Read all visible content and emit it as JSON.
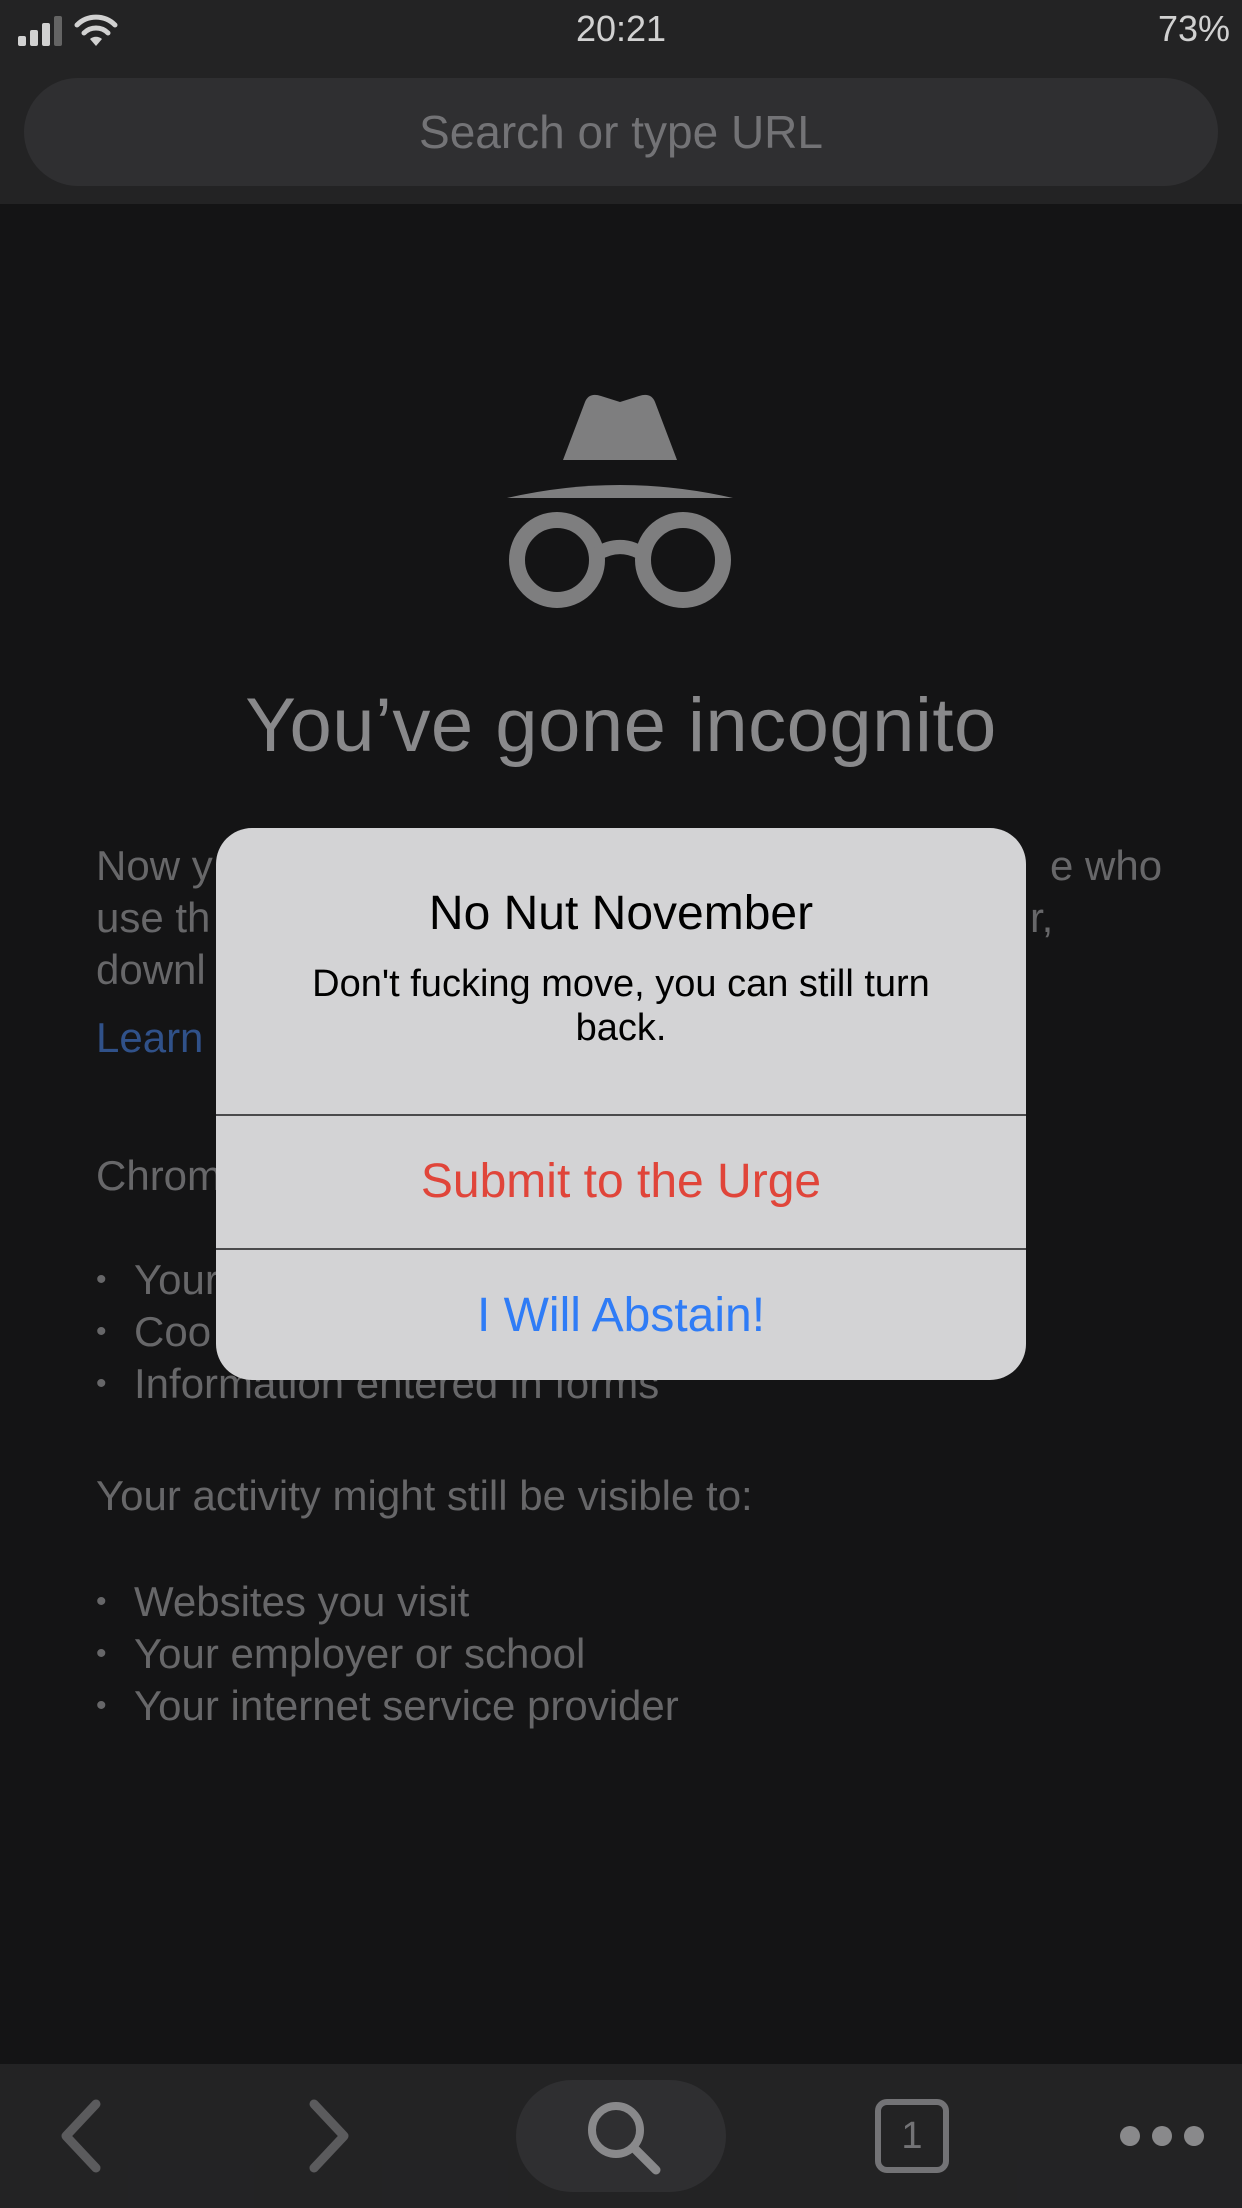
{
  "status_bar": {
    "time": "20:21",
    "battery": "73%"
  },
  "omnibox": {
    "placeholder": "Search or type URL"
  },
  "incognito": {
    "title": "You’ve gone incognito",
    "intro_visible_lines": [
      "Now y",
      "use th",
      "downl"
    ],
    "intro_right_fragments": [
      "e who",
      "r,"
    ],
    "learn_more": "Learn",
    "chrome_fragment": "Chrom",
    "not_saved_items": [
      "Your",
      "Coo",
      "Information entered in forms"
    ],
    "visible_to_heading": "Your activity might still be visible to:",
    "visible_to_items": [
      "Websites you visit",
      "Your employer or school",
      "Your internet service provider"
    ]
  },
  "alert": {
    "title": "No Nut November",
    "message": "Don't fucking move, you can still turn back.",
    "destructive_button": "Submit to the Urge",
    "default_button": "I Will Abstain!"
  },
  "toolbar": {
    "tab_count": "1",
    "icons": [
      "back-icon",
      "forward-icon",
      "search-icon",
      "tabs-icon",
      "more-icon"
    ]
  },
  "colors": {
    "destructive": "#e0453a",
    "default_action": "#2f7cf6",
    "link": "#3b63a8"
  }
}
